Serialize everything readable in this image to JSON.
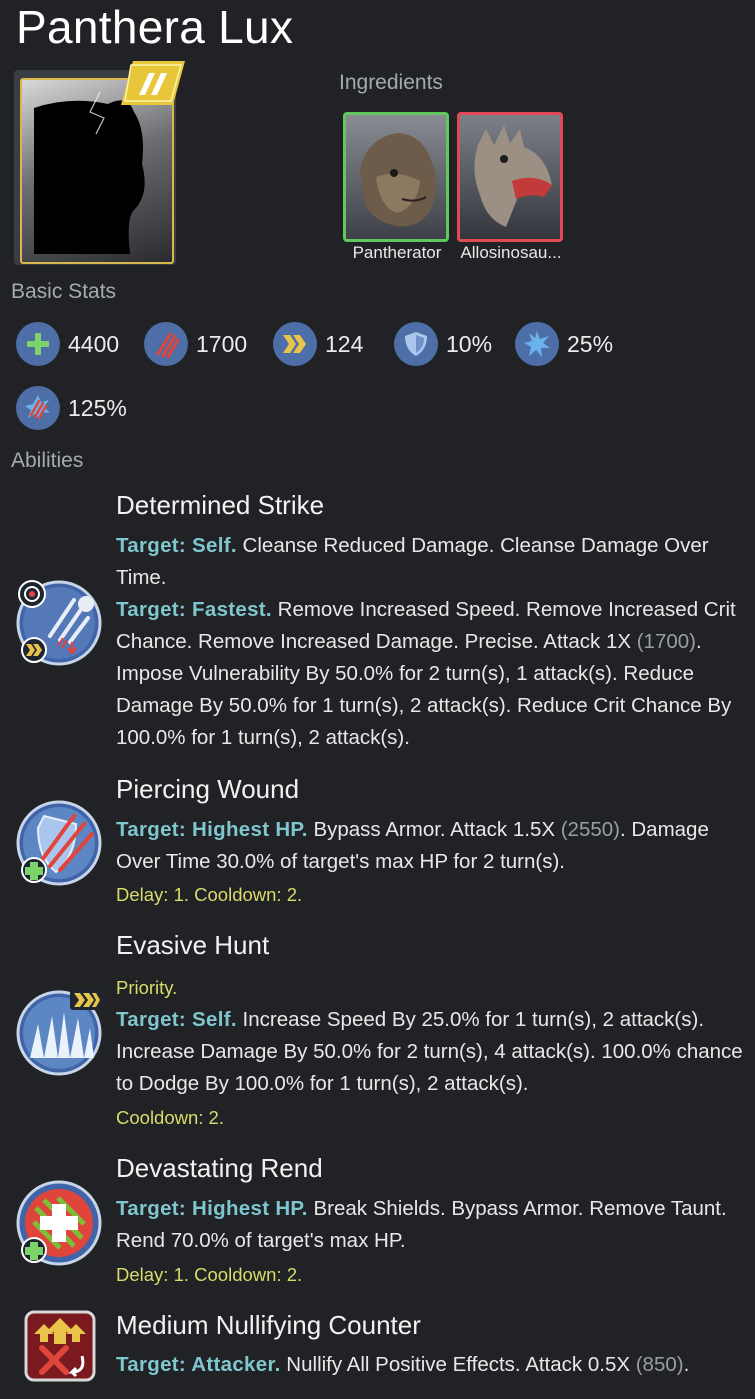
{
  "creature": {
    "name": "Panthera Lux"
  },
  "ingredients_label": "Ingredients",
  "ingredients": [
    {
      "name": "Pantherator",
      "border": "#5fc85f"
    },
    {
      "name": "Allosinosau...",
      "border": "#e04a55"
    }
  ],
  "basic_stats_label": "Basic Stats",
  "stats": [
    {
      "icon": "health-icon",
      "value": "4400"
    },
    {
      "icon": "damage-icon",
      "value": "1700"
    },
    {
      "icon": "speed-icon",
      "value": "124"
    },
    {
      "icon": "armor-icon",
      "value": "10%"
    },
    {
      "icon": "crit-chance-icon",
      "value": "25%"
    },
    {
      "icon": "crit-multiplier-icon",
      "value": "125%"
    }
  ],
  "abilities_label": "Abilities",
  "abilities": [
    {
      "name": "Determined Strike",
      "p1_target": "Target: Self.",
      "p1_text": " Cleanse Reduced Damage. Cleanse Damage Over Time.",
      "p2_target": "Target: Fastest.",
      "p2_text_a": " Remove Increased Speed. Remove Increased Crit Chance. Remove Increased Damage. Precise. Attack 1X ",
      "p2_dmg": "(1700)",
      "p2_text_b": ". Impose Vulnerability By 50.0% for 2 turn(s), 1 attack(s). Reduce Damage By 50.0% for 1 turn(s), 2 attack(s). Reduce Crit Chance By 100.0% for 1 turn(s), 2 attack(s)."
    },
    {
      "name": "Piercing Wound",
      "target": "Target: Highest HP.",
      "text_a": " Bypass Armor. Attack 1.5X ",
      "dmg": "(2550)",
      "text_b": ". Damage Over Time 30.0% of target's max HP for 2 turn(s).",
      "timing": "Delay: 1. Cooldown: 2."
    },
    {
      "name": "Evasive Hunt",
      "priority": "Priority.",
      "target": "Target: Self.",
      "text": " Increase Speed By 25.0% for 1 turn(s), 2 attack(s). Increase Damage By 50.0% for 2 turn(s), 4 attack(s). 100.0% chance to Dodge By 100.0% for 1 turn(s), 2 attack(s).",
      "timing": "Cooldown: 2."
    },
    {
      "name": "Devastating Rend",
      "target": "Target: Highest HP.",
      "text": " Break Shields. Bypass Armor. Remove Taunt. Rend 70.0% of target's max HP.",
      "timing": "Delay: 1. Cooldown: 2."
    },
    {
      "name": "Medium Nullifying Counter",
      "target": "Target: Attacker.",
      "text_a": " Nullify All Positive Effects. Attack 0.5X ",
      "dmg": "(850)",
      "text_b": "."
    }
  ],
  "colors": {
    "background": "#202225",
    "target_text": "#7fc6cf",
    "timing_text": "#d9db6a",
    "rarity_gold": "#e8c63a"
  }
}
